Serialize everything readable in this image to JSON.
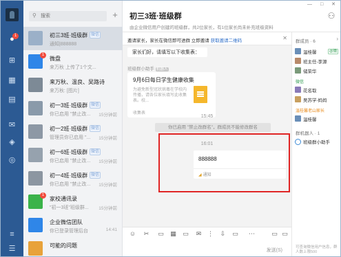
{
  "rail": {
    "chat_badge": "1"
  },
  "search": {
    "placeholder": "搜索"
  },
  "list": {
    "add_symbol": "+",
    "items": [
      {
        "name": "初三3班·班级群",
        "tag": "微信",
        "preview": "通知|888888",
        "time": "",
        "avatar_color": "#9bb0c8",
        "selected": true
      },
      {
        "name": "微盘",
        "tag": "",
        "preview": "来万秋 上传了1个文...",
        "time": "",
        "avatar_color": "#2f86e8",
        "badge": "1"
      },
      {
        "name": "来万秋、温良、吴路诗...",
        "tag": "",
        "preview": "来万秋: [图片]",
        "time": "",
        "avatar_color": "#7d8a96"
      },
      {
        "name": "初一3班·班级群",
        "tag": "微信",
        "preview": "你已启用 \"禁止改...",
        "time": "15分钟前",
        "avatar_color": "#8a9aaa"
      },
      {
        "name": "初一2班·班级群",
        "tag": "微信",
        "preview": "管理员你已启用 \"...",
        "time": "15分钟前",
        "avatar_color": "#8d98a5"
      },
      {
        "name": "初一6班·班级群",
        "tag": "微信",
        "preview": "你已启用 \"禁止改...",
        "time": "15分钟前",
        "avatar_color": "#96a2ae"
      },
      {
        "name": "初一4班·班级群",
        "tag": "微信",
        "preview": "你已启用 \"禁止改...",
        "time": "15分钟前",
        "avatar_color": "#8c96a1"
      },
      {
        "name": "家校通讯录",
        "tag": "",
        "preview": "\"初一3班\"班级群...",
        "time": "15分钟前",
        "avatar_color": "#3bb34a",
        "badge": "1"
      },
      {
        "name": "企业微信团队",
        "tag": "",
        "preview": "你已登录管理后台",
        "time": "14:41",
        "avatar_color": "#2f86e8"
      },
      {
        "name": "可能的问题",
        "tag": "",
        "preview": "",
        "time": "",
        "avatar_color": "#e8a23a"
      }
    ]
  },
  "header": {
    "title": "初三3班·班级群",
    "subtitle": "由企业微信用户创建的班级群，共2位家长，有1位家长尚未补充班级资料",
    "window_controls": "— □ ✕"
  },
  "chat": {
    "notice_text": "邀请家长，家长在微信即可进群 立即邀请",
    "notice_link": "获取邀请二维码",
    "first_bubble": "家长们好，请填写以下收集表：",
    "sender_name": "班级群小助手",
    "sender_tag": "机器人",
    "card_title": "9月6日每日学生健康收集",
    "card_desc": "为避免新型冠状病毒在学校内传播，请各位家长填写此收集表。校...",
    "card_footer": "收集表",
    "time1": "15:45",
    "system_msg": "你已启用 \"禁止改群名\"，群成员不能修改群名",
    "time2": "16:01",
    "message_text": "888888",
    "message_footer": "通知",
    "send_label": "发送(S)"
  },
  "toolbar": {
    "tools": [
      "☺",
      "✂",
      "▭",
      "▦",
      "▭",
      "✉",
      "⋮",
      "▭",
      "▭",
      "⋯",
      "▭",
      "▭"
    ]
  },
  "side": {
    "members_label": "群成员 · 6",
    "members": [
      {
        "name": "温桂馨",
        "ext": "@微",
        "color": "#6a8fb8"
      },
      {
        "name": "班主任-李源",
        "ext": "",
        "color": "#b88a6a"
      },
      {
        "name": "储荣华",
        "ext": "",
        "color": "#7a9a7a"
      }
    ],
    "wechat_group": "微信",
    "wechat_members": [
      {
        "name": "花名取",
        "ext": "",
        "color": "#8a7ab8"
      },
      {
        "name": "吴苏学-妈妈",
        "ext": "",
        "color": "#c8a060"
      }
    ],
    "parent_group": "温桂馨老山家长",
    "parent_members": [
      {
        "name": "温桂馨",
        "ext": "",
        "color": "#6a8fb8"
      }
    ],
    "robots_label": "群机器人 · 1",
    "robot_name": "班级群小助手",
    "footer": "可查询微信用户信息，群人数上限500"
  }
}
